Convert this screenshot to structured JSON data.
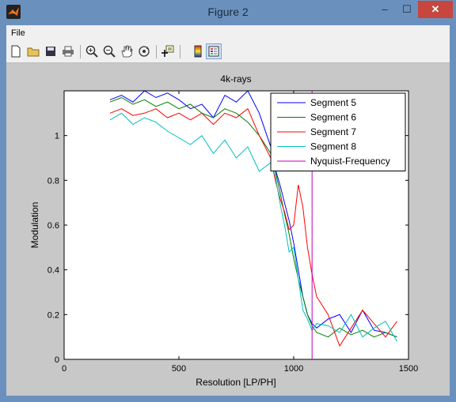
{
  "window": {
    "title": "Figure 2",
    "min_glyph": "–",
    "max_glyph": "☐",
    "close_glyph": "✕"
  },
  "menu": {
    "file": "File"
  },
  "toolbar": {
    "buttons": [
      "new-figure-icon",
      "open-folder-icon",
      "save-icon",
      "print-icon",
      "zoom-in-icon",
      "zoom-out-icon",
      "pan-hand-icon",
      "rotate-3d-icon",
      "data-cursor-icon",
      "colorbar-icon",
      "legend-icon"
    ],
    "active": "legend-icon"
  },
  "chart_data": {
    "type": "line",
    "title": "4k-rays",
    "xlabel": "Resolution [LP/PH]",
    "ylabel": "Modulation",
    "xlim": [
      0,
      1500
    ],
    "ylim": [
      0,
      1.2
    ],
    "xticks": [
      "0",
      "500",
      "1000",
      "1500"
    ],
    "yticks": [
      "0",
      "0.2",
      "0.4",
      "0.6",
      "0.8",
      "1"
    ],
    "legend_position": "top-right",
    "series": [
      {
        "name": "Segment 5",
        "color": "#0000ff",
        "x": [
          200,
          250,
          300,
          350,
          400,
          450,
          500,
          550,
          600,
          650,
          700,
          750,
          800,
          850,
          900,
          920,
          940,
          960,
          980,
          1000,
          1020,
          1040,
          1060,
          1080,
          1100,
          1150,
          1200,
          1250,
          1300,
          1350,
          1400,
          1450
        ],
        "y": [
          1.16,
          1.18,
          1.15,
          1.2,
          1.17,
          1.19,
          1.16,
          1.12,
          1.14,
          1.08,
          1.18,
          1.15,
          1.2,
          1.1,
          0.95,
          0.85,
          0.78,
          0.7,
          0.62,
          0.52,
          0.4,
          0.28,
          0.2,
          0.16,
          0.14,
          0.18,
          0.2,
          0.12,
          0.22,
          0.13,
          0.12,
          0.1
        ]
      },
      {
        "name": "Segment 6",
        "color": "#008000",
        "x": [
          200,
          250,
          300,
          350,
          400,
          450,
          500,
          550,
          600,
          650,
          700,
          750,
          800,
          850,
          900,
          920,
          940,
          960,
          980,
          1000,
          1020,
          1040,
          1060,
          1080,
          1100,
          1150,
          1200,
          1250,
          1300,
          1350,
          1400,
          1450
        ],
        "y": [
          1.15,
          1.17,
          1.14,
          1.16,
          1.13,
          1.15,
          1.12,
          1.14,
          1.1,
          1.08,
          1.12,
          1.1,
          1.06,
          1.0,
          0.92,
          0.84,
          0.75,
          0.65,
          0.56,
          0.45,
          0.36,
          0.28,
          0.2,
          0.15,
          0.12,
          0.1,
          0.14,
          0.11,
          0.13,
          0.1,
          0.12,
          0.1
        ]
      },
      {
        "name": "Segment 7",
        "color": "#ff0000",
        "x": [
          200,
          250,
          300,
          350,
          400,
          450,
          500,
          550,
          600,
          650,
          700,
          750,
          800,
          850,
          900,
          920,
          940,
          960,
          980,
          1000,
          1020,
          1040,
          1060,
          1080,
          1100,
          1150,
          1200,
          1250,
          1300,
          1350,
          1400,
          1450
        ],
        "y": [
          1.1,
          1.12,
          1.09,
          1.1,
          1.12,
          1.08,
          1.1,
          1.07,
          1.1,
          1.05,
          1.1,
          1.08,
          1.12,
          1.0,
          0.9,
          0.8,
          0.72,
          0.66,
          0.58,
          0.6,
          0.78,
          0.68,
          0.5,
          0.38,
          0.28,
          0.2,
          0.06,
          0.14,
          0.22,
          0.16,
          0.1,
          0.17
        ]
      },
      {
        "name": "Segment 8",
        "color": "#00bfbf",
        "x": [
          200,
          250,
          300,
          350,
          400,
          450,
          500,
          550,
          600,
          650,
          700,
          750,
          800,
          850,
          900,
          920,
          940,
          960,
          980,
          1000,
          1020,
          1040,
          1060,
          1080,
          1100,
          1150,
          1200,
          1250,
          1300,
          1350,
          1400,
          1450
        ],
        "y": [
          1.07,
          1.1,
          1.05,
          1.08,
          1.06,
          1.02,
          0.99,
          0.96,
          1.0,
          0.92,
          0.98,
          0.9,
          0.95,
          0.84,
          0.88,
          0.82,
          0.7,
          0.6,
          0.48,
          0.5,
          0.36,
          0.22,
          0.18,
          0.13,
          0.16,
          0.15,
          0.12,
          0.2,
          0.1,
          0.14,
          0.17,
          0.08
        ]
      },
      {
        "name": "Nyquist-Frequency",
        "color": "#bf00bf",
        "x": [
          1080,
          1080
        ],
        "y": [
          0,
          1.2
        ]
      }
    ]
  }
}
